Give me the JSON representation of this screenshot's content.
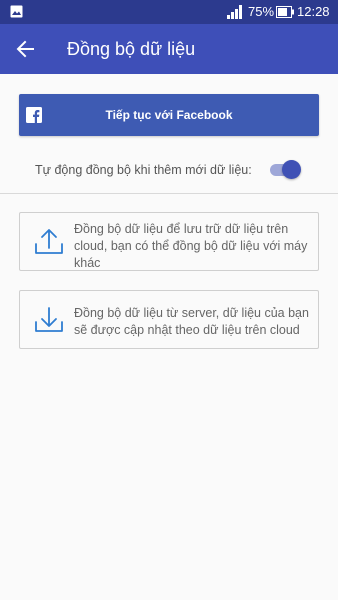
{
  "status_bar": {
    "battery_percent": "75%",
    "time": "12:28",
    "icons": [
      "gallery-icon",
      "signal-icon",
      "battery-icon"
    ]
  },
  "app_bar": {
    "title": "Đồng bộ dữ liệu",
    "back_icon": "arrow-back-icon"
  },
  "facebook_button": {
    "label": "Tiếp tục với Facebook",
    "icon": "facebook-icon"
  },
  "auto_sync": {
    "label": "Tự động đồng bộ khi thêm mới dữ liệu:",
    "enabled": true
  },
  "sync_options": [
    {
      "icon": "upload-icon",
      "text": "Đồng bộ dữ liệu để lưu trữ dữ liệu trên cloud, bạn có thể đồng bộ dữ liệu với máy khác"
    },
    {
      "icon": "download-icon",
      "text": "Đồng bộ dữ liệu từ server, dữ liệu của bạn sẽ được cập nhật theo dữ liệu trên cloud"
    }
  ],
  "colors": {
    "status_bar": "#2c3a8e",
    "app_bar": "#3e4fb8",
    "facebook": "#3e5bb3",
    "toggle_thumb": "#3f51b5",
    "icon_blue": "#2f7dd1"
  }
}
